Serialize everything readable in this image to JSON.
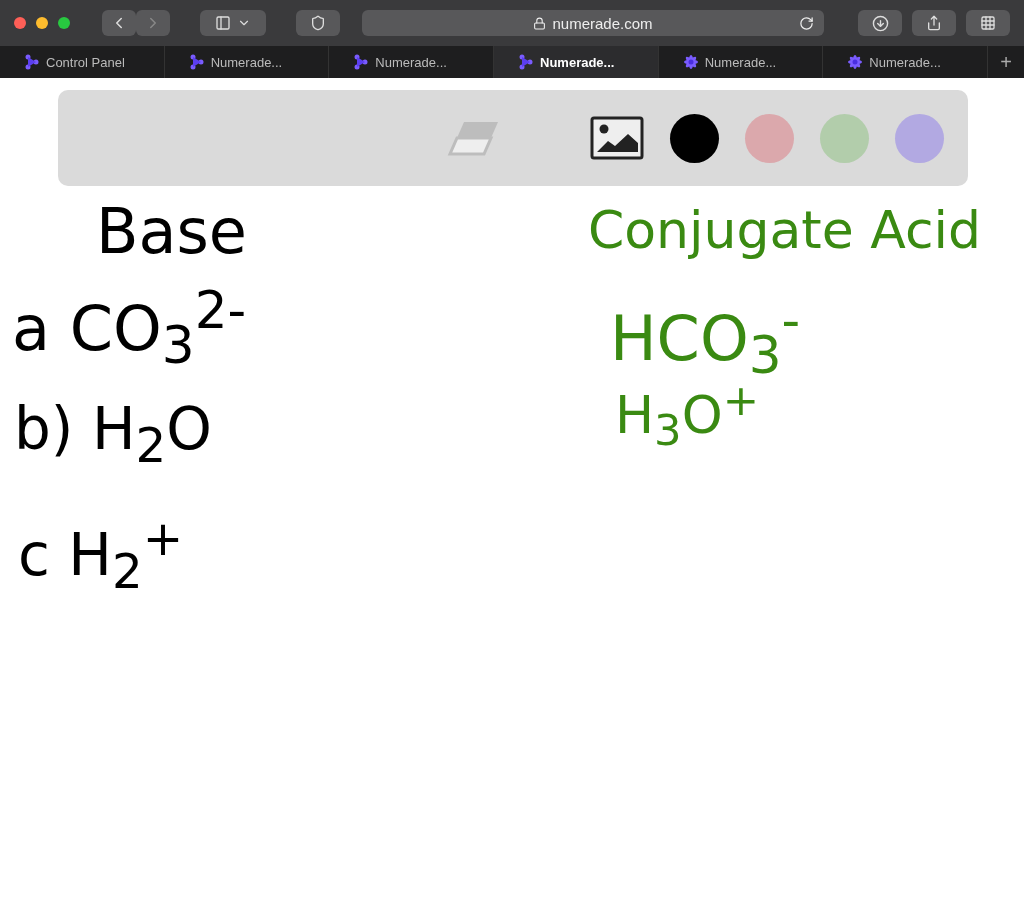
{
  "browser": {
    "address": "numerade.com",
    "tabs": [
      {
        "label": "Control Panel",
        "kind": "logo",
        "selected": false
      },
      {
        "label": "Numerade...",
        "kind": "logo",
        "selected": false
      },
      {
        "label": "Numerade...",
        "kind": "logo",
        "selected": false
      },
      {
        "label": "Numerade...",
        "kind": "logo",
        "selected": true
      },
      {
        "label": "Numerade...",
        "kind": "flower",
        "selected": false
      },
      {
        "label": "Numerade...",
        "kind": "flower",
        "selected": false
      }
    ],
    "new_tab": "+"
  },
  "toolbar": {
    "swatches": [
      {
        "color": "#000000"
      },
      {
        "color": "#dba8ac"
      },
      {
        "color": "#b2cdab"
      },
      {
        "color": "#b2a9e2"
      }
    ]
  },
  "board": [
    {
      "text": "Base",
      "color": "#000000"
    },
    {
      "text": "a CO$_{3}$$^{2-}$",
      "color": "#000000"
    },
    {
      "text": "b) H$_{2}$O",
      "color": "#000000"
    },
    {
      "text": "c H$_{2}$$^{+}$",
      "color": "#000000"
    },
    {
      "text": "Conjugate Acid",
      "color": "#3a8a12"
    },
    {
      "text": "HCO$_{3}$$^{-}$",
      "color": "#3a8a12"
    },
    {
      "text": "H$_{3}$O$^{+}$",
      "color": "#3a8a12"
    }
  ]
}
